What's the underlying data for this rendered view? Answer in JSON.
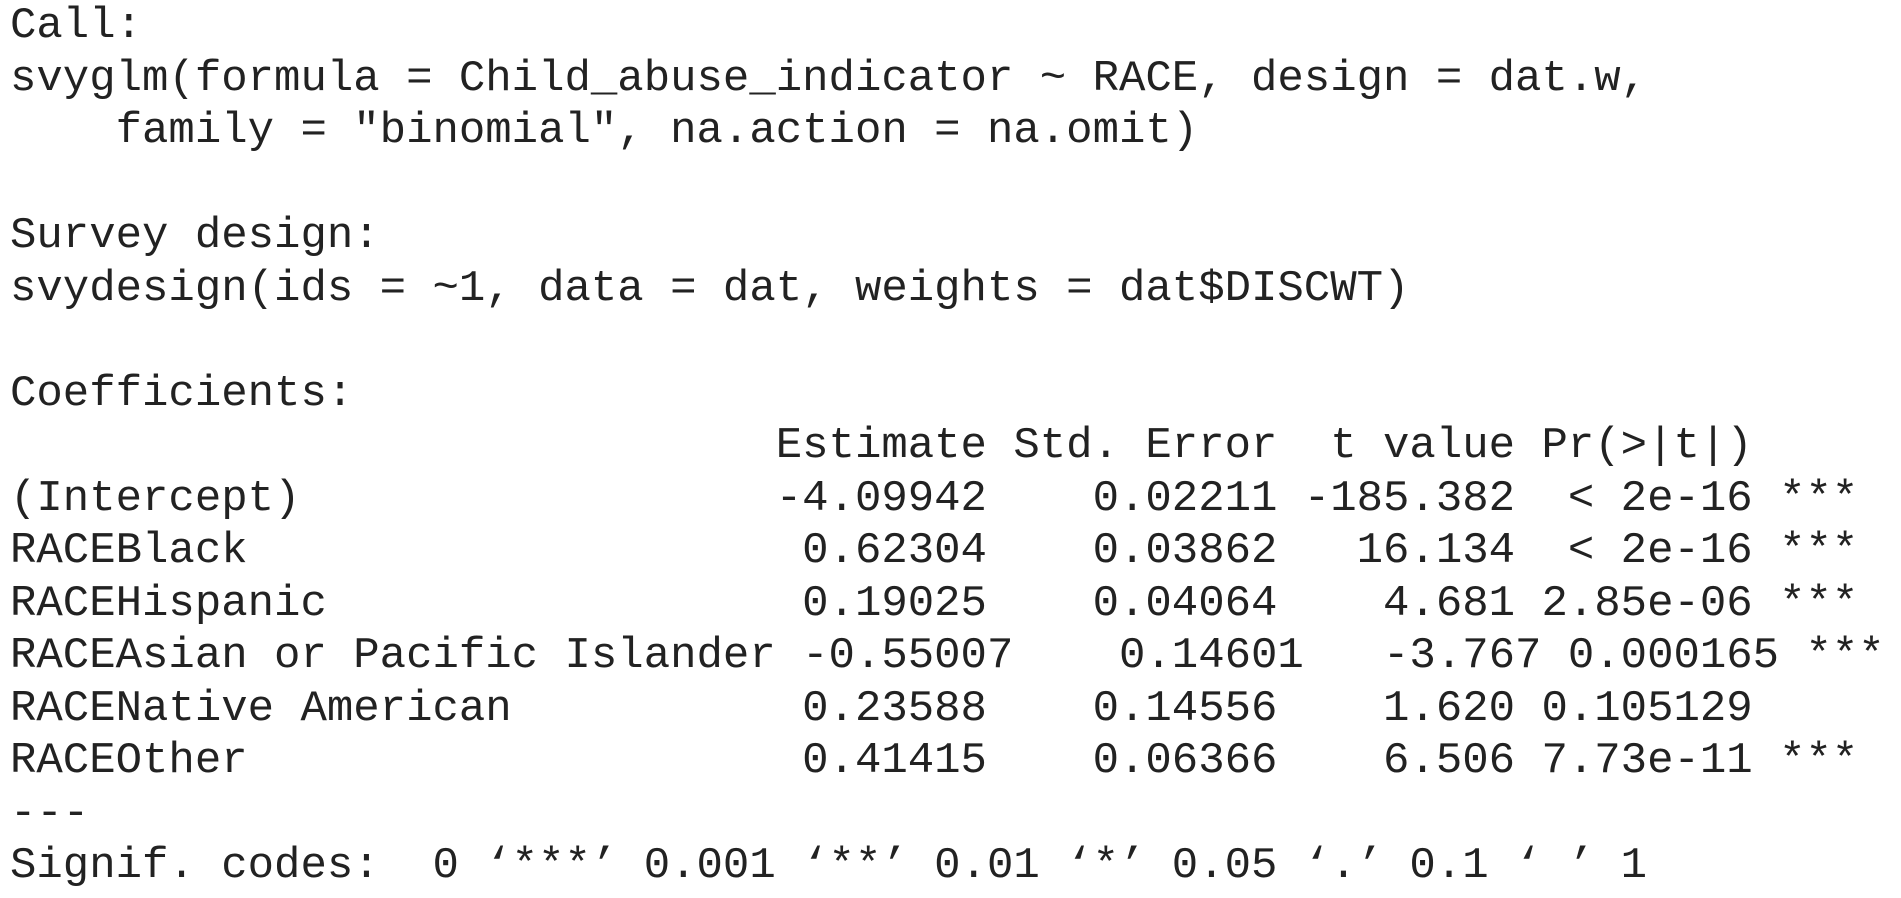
{
  "call": {
    "label": "Call:",
    "line1": "svyglm(formula = Child_abuse_indicator ~ RACE, design = dat.w, ",
    "line2": "    family = \"binomial\", na.action = na.omit)"
  },
  "survey_design": {
    "label": "Survey design:",
    "line1": "svydesign(ids = ~1, data = dat, weights = dat$DISCWT)"
  },
  "coefficients": {
    "label": "Coefficients:",
    "header": "                             Estimate Std. Error  t value Pr(>|t|)    ",
    "rows": [
      "(Intercept)                  -4.09942    0.02211 -185.382  < 2e-16 ***",
      "RACEBlack                     0.62304    0.03862   16.134  < 2e-16 ***",
      "RACEHispanic                  0.19025    0.04064    4.681 2.85e-06 ***",
      "RACEAsian or Pacific Islander -0.55007    0.14601   -3.767 0.000165 ***",
      "RACENative American           0.23588    0.14556    1.620 0.105129    ",
      "RACEOther                     0.41415    0.06366    6.506 7.73e-11 ***"
    ],
    "separator": "---",
    "signif_codes": "Signif. codes:  0 ‘***’ 0.001 ‘**’ 0.01 ‘*’ 0.05 ‘.’ 0.1 ‘ ’ 1"
  }
}
